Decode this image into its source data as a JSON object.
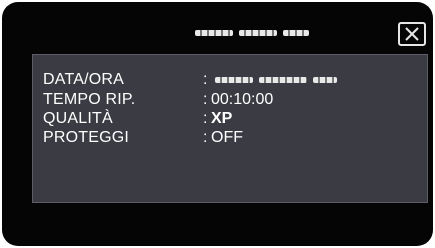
{
  "header": {
    "title_redacted": true,
    "close_icon": "close-icon"
  },
  "info": {
    "rows": [
      {
        "label": "DATA/ORA",
        "separator": ":",
        "value": ""
      },
      {
        "label": "TEMPO RIP.",
        "separator": ":",
        "value": "00:10:00"
      },
      {
        "label": "QUALITÀ",
        "separator": ":",
        "value": "XP"
      },
      {
        "label": "PROTEGGI",
        "separator": ":",
        "value": "OFF"
      }
    ]
  },
  "colors": {
    "screen_bg": "#050505",
    "panel_bg": "#3b3c43",
    "text": "#ffffff"
  }
}
